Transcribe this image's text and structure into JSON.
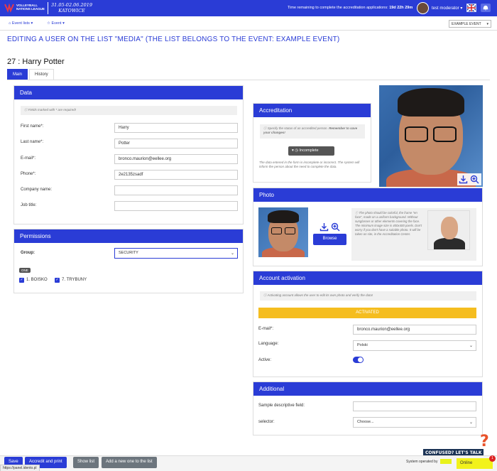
{
  "brand": {
    "logo_text": "VOLLEYBALL NATIONS LEAGUE",
    "dates": "31.05-02.06.2019",
    "city": "KATOWICE"
  },
  "topbar": {
    "remaining_label": "Time remaining to complete the accreditation applications:",
    "remaining_value": "19d 22h 29m",
    "user": "test moderator"
  },
  "subnav": {
    "event_lists": "Event lists",
    "event": "Event",
    "event_select": "EXAMPLE EVENT"
  },
  "page": {
    "title": "EDITING A USER ON THE LIST \"MEDIA\" (THE LIST BELONGS TO THE EVENT: EXAMPLE EVENT)",
    "person": "27 : Harry Potter"
  },
  "tabs": [
    "Main",
    "History"
  ],
  "data_card": {
    "title": "Data",
    "required_hint": "Fields marked with * are required!",
    "fields": [
      {
        "label": "First name*:",
        "value": "Harry"
      },
      {
        "label": "Last name*:",
        "value": "Potter"
      },
      {
        "label": "E-mail*:",
        "value": "bronco.maurion@eellee.org"
      },
      {
        "label": "Phone*:",
        "value": "2e2135zsadf"
      },
      {
        "label": "Company name:",
        "value": ""
      },
      {
        "label": "Job title:",
        "value": ""
      }
    ]
  },
  "permissions": {
    "title": "Permissions",
    "group_label": "Group:",
    "group_value": "SECURITY",
    "badge": "ONE",
    "options": [
      "1. BOISKO",
      "7. TRYBUNY"
    ]
  },
  "accreditation": {
    "title": "Accreditation",
    "hint": "Specify the status of an accredited person.",
    "hint_bold": "Remember to save your changes!",
    "status": "Incomplete",
    "note": "The data entered in the form is incomplete or incorrect. The system will inform the person about the need to complete the data."
  },
  "photo": {
    "title": "Photo",
    "browse": "Browse",
    "hint": "The photo should be colorful, the frame \"en face\", made on a uniform background. Without sunglasses or other elements covering the face. The minimum image size is 400x400 pixels. Don't worry if you don't have a suitable photo. It will be taken on site, in the Accreditation Center."
  },
  "activation": {
    "title": "Account activation",
    "hint": "Activating account allows the user to edit its own photo and verify the data!",
    "status": "ACTIVATED",
    "email_label": "E-mail*:",
    "email_value": "bronco.maurion@eellee.org",
    "language_label": "Language:",
    "language_value": "Polski",
    "active_label": "Active:"
  },
  "additional": {
    "title": "Additional",
    "field1_label": "Sample descriptive field:",
    "field2_label": "selector:",
    "field2_value": "Choose..."
  },
  "footer": {
    "save": "Save",
    "accredit_print": "Accredit and print",
    "show_list": "Show list",
    "add_new": "Add a new one to the list",
    "url": "https://panel.idento.pl",
    "operated_by": "System operated by",
    "online": "Online",
    "online_count": "1",
    "confused": "CONFUSED? LET'S TALK"
  },
  "colors": {
    "primary": "#2a3cd6",
    "activated": "#f5bd1f",
    "online": "#f2f21b",
    "help": "#e8522a"
  }
}
